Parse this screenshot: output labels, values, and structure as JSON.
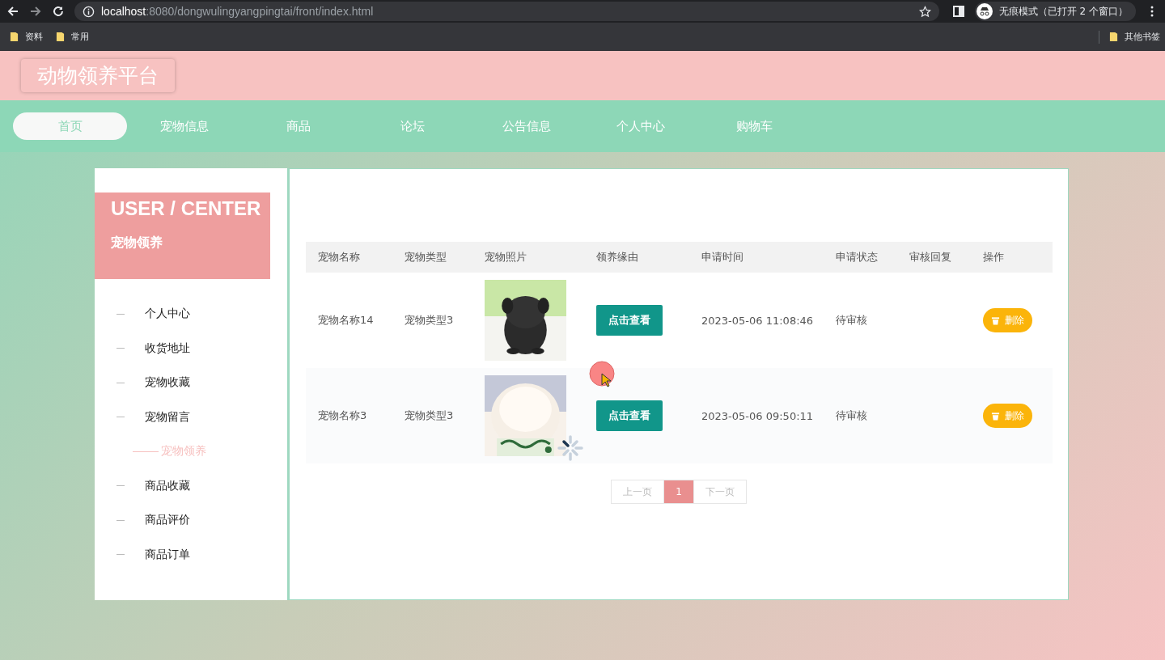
{
  "browser": {
    "url_host": "localhost",
    "url_path": ":8080/dongwulingyangpingtai/front/index.html",
    "profile": "无痕模式（已打开 2 个窗口）",
    "bookmarks": [
      "资料",
      "常用"
    ],
    "other_bookmarks": "其他书签"
  },
  "site_title": "动物领养平台",
  "nav": [
    {
      "label": "首页",
      "selected": true
    },
    {
      "label": "宠物信息",
      "selected": false
    },
    {
      "label": "商品",
      "selected": false
    },
    {
      "label": "论坛",
      "selected": false
    },
    {
      "label": "公告信息",
      "selected": false
    },
    {
      "label": "个人中心",
      "selected": false
    },
    {
      "label": "购物车",
      "selected": false
    }
  ],
  "sidebar": {
    "heading": "USER / CENTER",
    "subheading": "宠物领养",
    "items": [
      {
        "label": "个人中心",
        "selected": false
      },
      {
        "label": "收货地址",
        "selected": false
      },
      {
        "label": "宠物收藏",
        "selected": false
      },
      {
        "label": "宠物留言",
        "selected": false
      },
      {
        "label": "宠物领养",
        "selected": true
      },
      {
        "label": "商品收藏",
        "selected": false
      },
      {
        "label": "商品评价",
        "selected": false
      },
      {
        "label": "商品订单",
        "selected": false
      }
    ]
  },
  "table": {
    "columns": [
      "宠物名称",
      "宠物类型",
      "宠物照片",
      "领养缘由",
      "申请时间",
      "申请状态",
      "审核回复",
      "操作"
    ],
    "rows": [
      {
        "name": "宠物名称14",
        "type": "宠物类型3",
        "reason_button": "点击查看",
        "time": "2023-05-06 11:08:46",
        "status": "待审核",
        "delete_button": "删除"
      },
      {
        "name": "宠物名称3",
        "type": "宠物类型3",
        "reason_button": "点击查看",
        "time": "2023-05-06 09:50:11",
        "status": "待审核",
        "delete_button": "删除"
      }
    ]
  },
  "pagination": {
    "prev": "上一页",
    "pages": [
      {
        "label": "1",
        "selected": true
      }
    ],
    "next": "下一页"
  }
}
